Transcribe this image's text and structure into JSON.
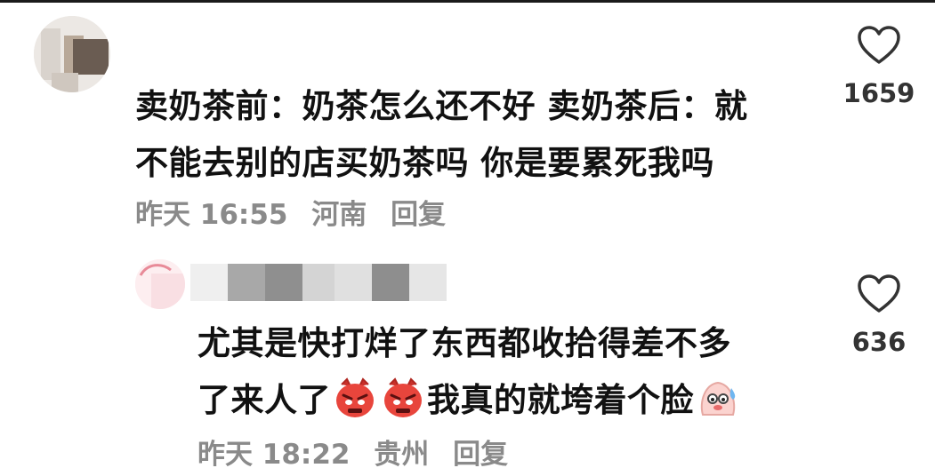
{
  "comments": [
    {
      "text_line1": "卖奶茶前：奶茶怎么还不好 卖奶茶后：就",
      "text_line2": "不能去别的店买奶茶吗 你是要累死我吗",
      "time": "昨天 16:55",
      "location": "河南",
      "reply_label": "回复",
      "likes": "1659",
      "avatar_icon": "blurred-avatar-icon"
    },
    {
      "text_line1": "尤其是快打烊了东西都收拾得差不多",
      "text_line2_part1": "了来人了",
      "text_line2_part2": "我真的就垮着个脸",
      "emojis": [
        "angry-face-emoji",
        "angry-face-emoji",
        "sweating-face-emoji"
      ],
      "time": "昨天 18:22",
      "location": "贵州",
      "reply_label": "回复",
      "likes": "636",
      "avatar_icon": "blurred-avatar-icon"
    }
  ],
  "colors": {
    "text": "#111111",
    "meta": "#8a8a8a",
    "icon": "#333333",
    "emoji_angry": "#e8453c"
  }
}
